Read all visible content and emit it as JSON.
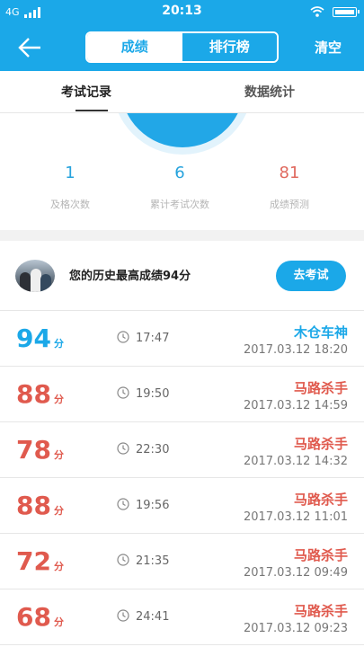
{
  "status": {
    "network": "4G",
    "time": "20:13"
  },
  "nav": {
    "segment_active": "成绩",
    "segment_inactive": "排行榜",
    "clear": "清空"
  },
  "subtabs": {
    "active": "考试记录",
    "inactive": "数据统计"
  },
  "stats": [
    {
      "value": "1",
      "label": "及格次数",
      "color": "#27a3dd"
    },
    {
      "value": "6",
      "label": "累计考试次数",
      "color": "#27a3dd"
    },
    {
      "value": "81",
      "label": "成绩预测",
      "color": "#e06a5f"
    }
  ],
  "best": {
    "text": "您的历史最高成绩94分",
    "button": "去考试"
  },
  "records": [
    {
      "score": "94",
      "unit": "分",
      "duration": "17:47",
      "title": "木仓车神",
      "date": "2017.03.12  18:20",
      "color": "#1ba8e8"
    },
    {
      "score": "88",
      "unit": "分",
      "duration": "19:50",
      "title": "马路杀手",
      "date": "2017.03.12  14:59",
      "color": "#e05a4e"
    },
    {
      "score": "78",
      "unit": "分",
      "duration": "22:30",
      "title": "马路杀手",
      "date": "2017.03.12  14:32",
      "color": "#e05a4e"
    },
    {
      "score": "88",
      "unit": "分",
      "duration": "19:56",
      "title": "马路杀手",
      "date": "2017.03.12  11:01",
      "color": "#e05a4e"
    },
    {
      "score": "72",
      "unit": "分",
      "duration": "21:35",
      "title": "马路杀手",
      "date": "2017.03.12  09:49",
      "color": "#e05a4e"
    },
    {
      "score": "68",
      "unit": "分",
      "duration": "24:41",
      "title": "马路杀手",
      "date": "2017.03.12  09:23",
      "color": "#e05a4e"
    }
  ],
  "colors": {
    "primary": "#1ba8e8",
    "danger": "#e05a4e"
  }
}
